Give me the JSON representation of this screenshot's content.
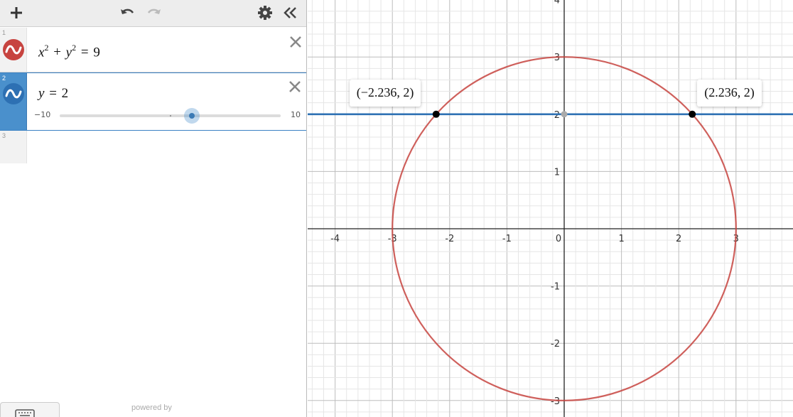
{
  "toolbar": {
    "add_icon": "plus-icon",
    "undo_icon": "undo-icon",
    "redo_icon": "redo-icon",
    "settings_icon": "gear-icon",
    "collapse_icon": "double-chevron-left-icon"
  },
  "expressions": [
    {
      "index": "1",
      "color": "#c74440",
      "latex_parts": {
        "x": "x",
        "xexp": "2",
        "plus": "+",
        "y": "y",
        "yexp": "2",
        "eq": "=",
        "rhs": "9"
      }
    },
    {
      "index": "2",
      "color": "#2d70b3",
      "lhs": "y",
      "eq": "=",
      "rhs": "2",
      "slider": {
        "min": "−10",
        "max": "10",
        "value": 2
      }
    },
    {
      "index": "3"
    }
  ],
  "footer": {
    "powered_by": "powered by",
    "keyboard_icon": "keyboard-icon"
  },
  "graph": {
    "x_ticks": [
      "-4",
      "-3",
      "-2",
      "-1",
      "0",
      "1",
      "2",
      "3"
    ],
    "y_ticks": [
      "4",
      "3",
      "2",
      "1",
      "-1",
      "-2",
      "-3"
    ],
    "circle_color": "#c74440",
    "line_color": "#2d70b3",
    "points": [
      {
        "label": "(−2.236, 2)",
        "x": -2.236,
        "y": 2
      },
      {
        "label": "(2.236, 2)",
        "x": 2.236,
        "y": 2
      }
    ]
  }
}
